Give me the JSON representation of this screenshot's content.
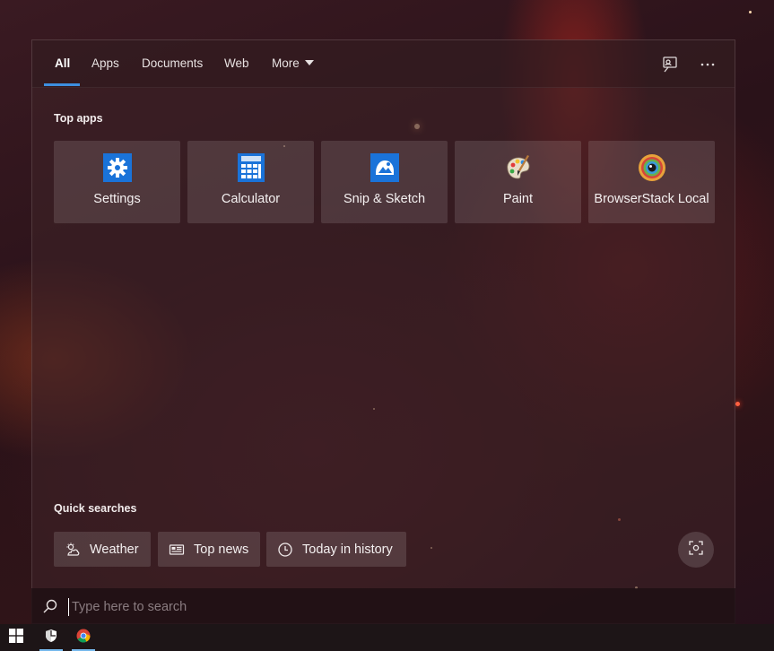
{
  "tabs": [
    {
      "label": "All",
      "active": true
    },
    {
      "label": "Apps"
    },
    {
      "label": "Documents"
    },
    {
      "label": "Web"
    },
    {
      "label": "More"
    }
  ],
  "header_icons": [
    "feedback-icon",
    "more-options-icon"
  ],
  "top_apps": {
    "title": "Top apps",
    "items": [
      {
        "label": "Settings",
        "icon": "gear-icon"
      },
      {
        "label": "Calculator",
        "icon": "calculator-icon"
      },
      {
        "label": "Snip & Sketch",
        "icon": "snip-sketch-icon"
      },
      {
        "label": "Paint",
        "icon": "paint-palette-icon"
      },
      {
        "label": "BrowserStack Local",
        "icon": "browserstack-icon"
      }
    ]
  },
  "quick_searches": {
    "title": "Quick searches",
    "items": [
      {
        "label": "Weather",
        "icon": "weather-icon"
      },
      {
        "label": "Top news",
        "icon": "news-icon"
      },
      {
        "label": "Today in history",
        "icon": "clock-icon"
      }
    ]
  },
  "search": {
    "placeholder": "Type here to search",
    "value": ""
  },
  "taskbar": {
    "items": [
      "windows-start-icon",
      "windows-security-icon",
      "chrome-icon"
    ]
  },
  "colors": {
    "accent": "#3d8fe0",
    "settings_icon_bg": "#1a73d9",
    "calculator_icon_bg": "#1a73d9",
    "snip_icon_bg": "#1a73d9"
  }
}
